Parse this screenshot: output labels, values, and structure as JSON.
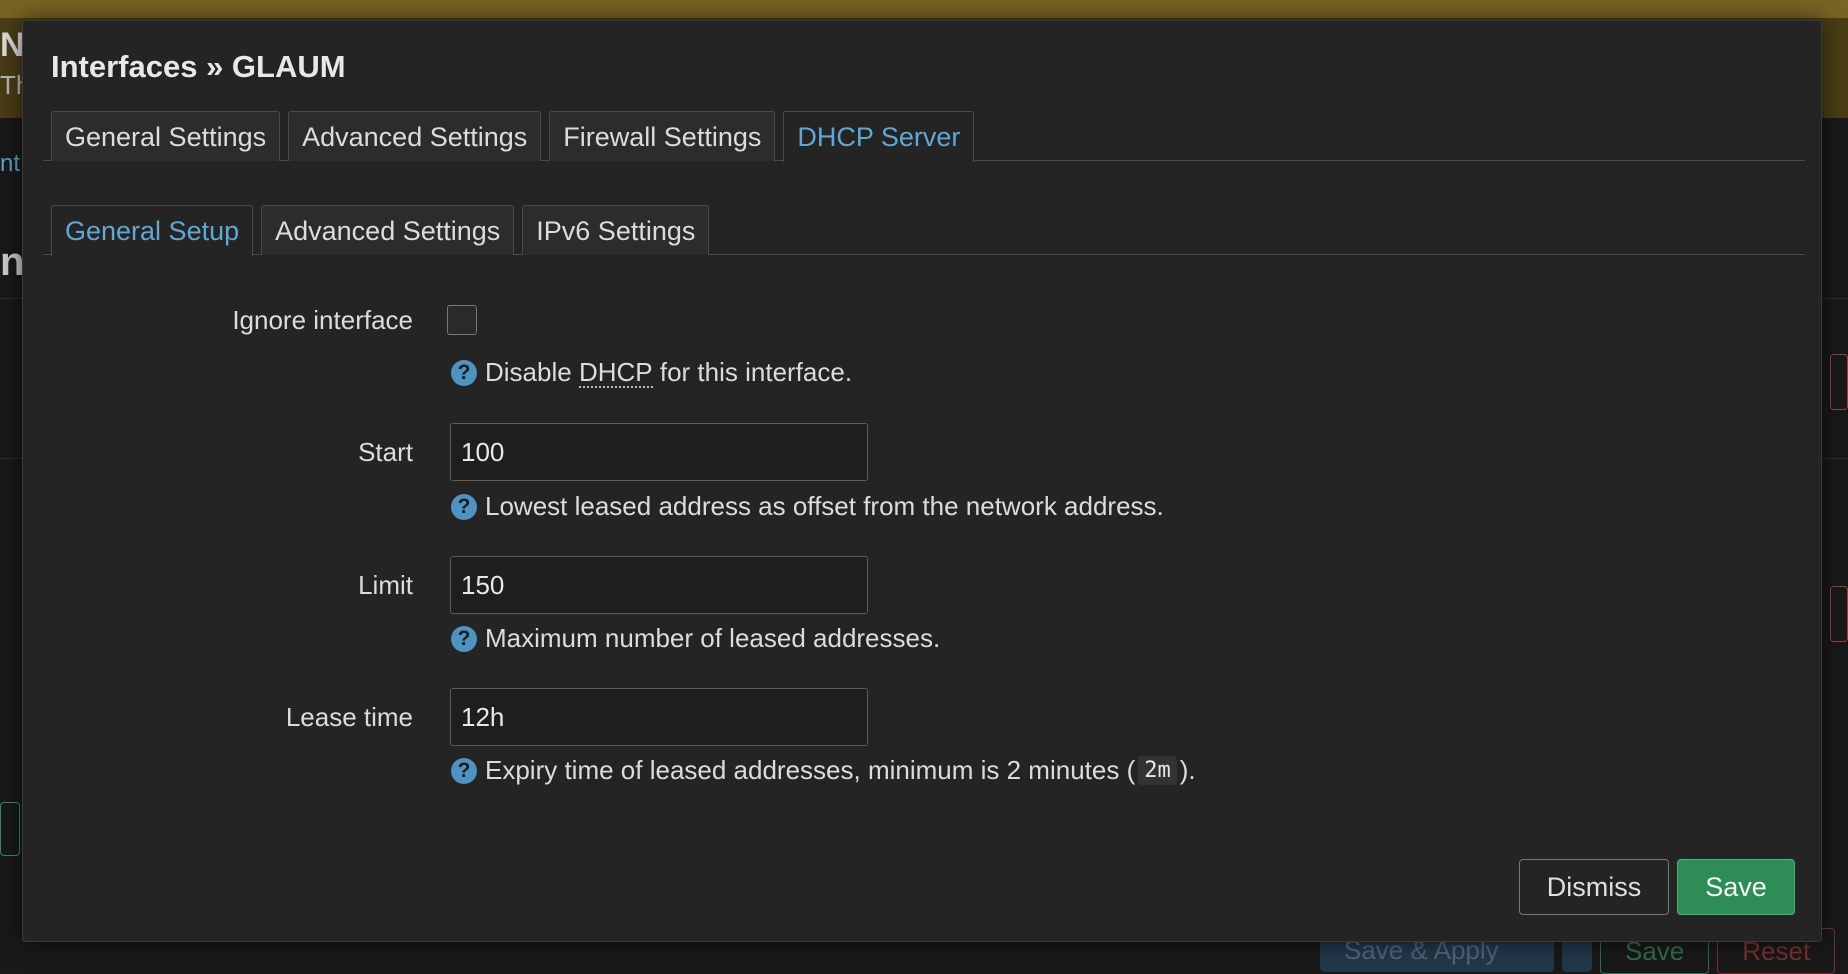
{
  "background": {
    "peek_top": "N",
    "peek_sub": "Th",
    "peek_link": "nt",
    "peek_heading": "nt",
    "buttons": {
      "apply": "Save & Apply",
      "save": "Save",
      "reset": "Reset"
    }
  },
  "modal": {
    "title": "Interfaces » GLAUM",
    "primary_tabs": [
      "General Settings",
      "Advanced Settings",
      "Firewall Settings",
      "DHCP Server"
    ],
    "secondary_tabs": [
      "General Setup",
      "Advanced Settings",
      "IPv6 Settings"
    ],
    "fields": {
      "ignore": {
        "label": "Ignore interface",
        "checked": false,
        "help_pre": "Disable",
        "help_abbr": "DHCP",
        "help_post": "for this interface."
      },
      "start": {
        "label": "Start",
        "value": "100",
        "help": "Lowest leased address as offset from the network address."
      },
      "limit": {
        "label": "Limit",
        "value": "150",
        "help": "Maximum number of leased addresses."
      },
      "leasetime": {
        "label": "Lease time",
        "value": "12h",
        "help_pre": "Expiry time of leased addresses, minimum is 2 minutes (",
        "help_code": "2m",
        "help_post": ")."
      }
    },
    "buttons": {
      "dismiss": "Dismiss",
      "save": "Save"
    },
    "help_glyph": "?"
  },
  "colors": {
    "accent": "#5fa8d3",
    "save_green": "#2e8c57",
    "modal_bg": "#242424",
    "help_icon": "#4f93c2"
  }
}
